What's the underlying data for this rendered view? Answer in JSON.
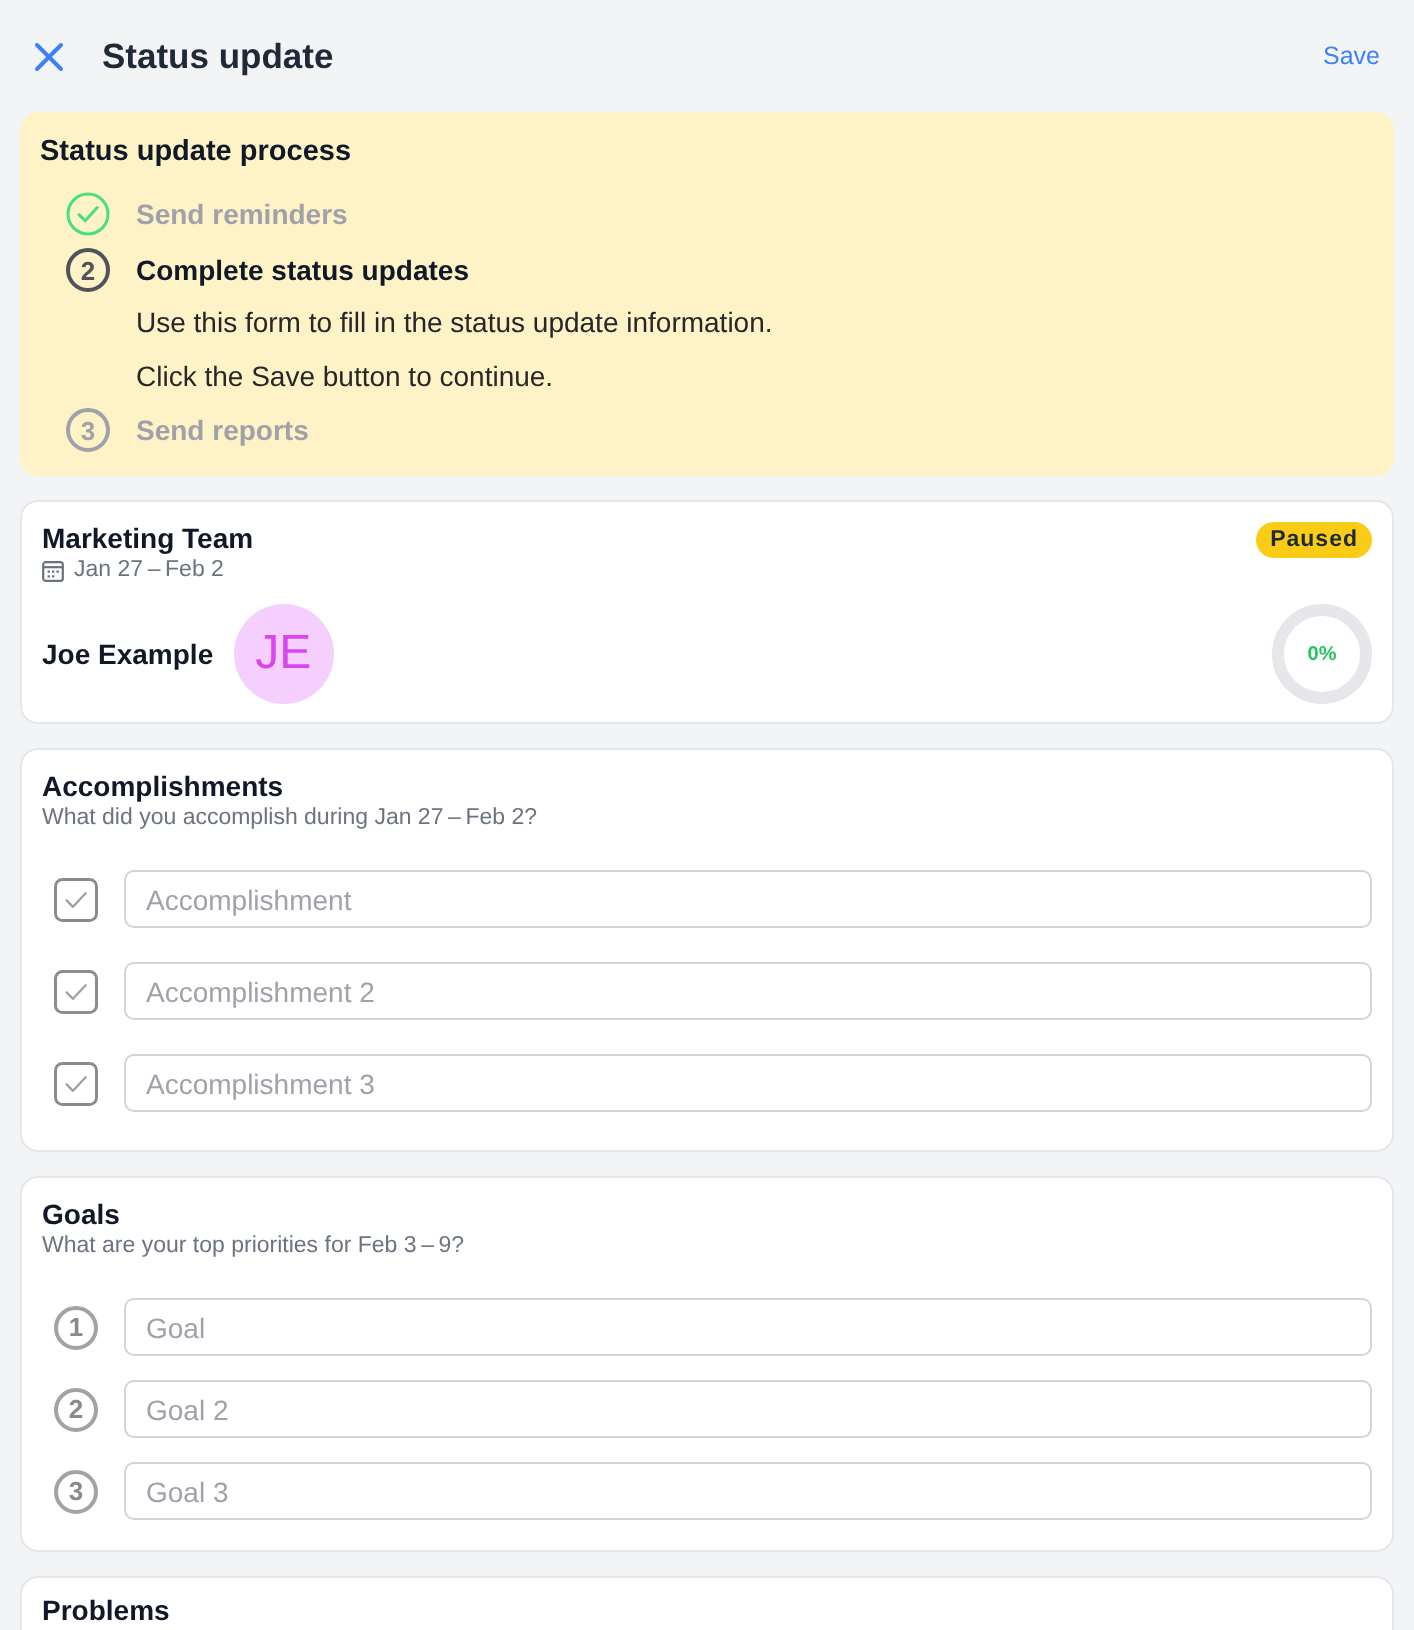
{
  "header": {
    "title": "Status update",
    "action": "Save"
  },
  "process": {
    "title": "Status update process",
    "steps": [
      {
        "label": "Send reminders",
        "completed": true,
        "active": false
      },
      {
        "number": "2",
        "label": "Complete status updates",
        "completed": false,
        "active": true,
        "description": [
          "Use this form to fill in the status update information.",
          "Click the Save button to continue."
        ]
      },
      {
        "number": "3",
        "label": "Send reports",
        "completed": false,
        "active": false
      }
    ]
  },
  "summary": {
    "team": "Marketing Team",
    "date_range": "Jan 27 – Feb 2",
    "badge": "Paused",
    "person": "Joe Example",
    "initials": "JE",
    "progress": {
      "reading": "0%"
    }
  },
  "sections": [
    {
      "kind": "checklist",
      "title": "Accomplishments",
      "prompt": "What did you accomplish during Jan 27 – Feb 2?",
      "items": [
        {
          "placeholder": "Accomplishment",
          "checked": false
        },
        {
          "placeholder": "Accomplishment 2",
          "checked": false
        },
        {
          "placeholder": "Accomplishment 3",
          "checked": false
        }
      ]
    },
    {
      "kind": "numbered",
      "title": "Goals",
      "prompt": "What are your top priorities for Feb 3 – 9?",
      "items": [
        {
          "number": "1",
          "placeholder": "Goal"
        },
        {
          "number": "2",
          "placeholder": "Goal 2"
        },
        {
          "number": "3",
          "placeholder": "Goal 3"
        }
      ]
    },
    {
      "kind": "heading",
      "title": "Problems"
    }
  ]
}
